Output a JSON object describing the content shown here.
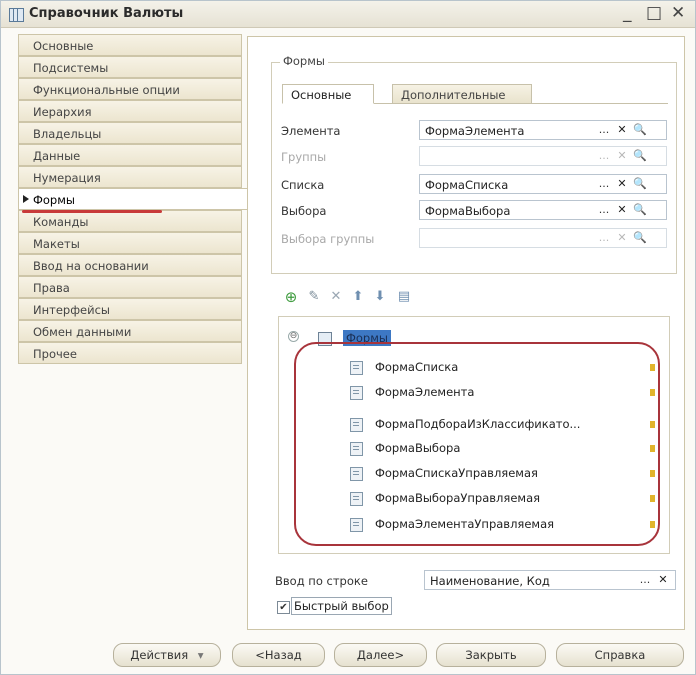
{
  "window": {
    "title": "Справочник Валюты",
    "controls": {
      "minimize": "_",
      "maximize": "□",
      "close": "✕"
    }
  },
  "sidebar": {
    "items": [
      {
        "label": "Основные"
      },
      {
        "label": "Подсистемы"
      },
      {
        "label": "Функциональные опции"
      },
      {
        "label": "Иерархия"
      },
      {
        "label": "Владельцы"
      },
      {
        "label": "Данные"
      },
      {
        "label": "Нумерация"
      },
      {
        "label": "Формы",
        "active": true
      },
      {
        "label": "Команды"
      },
      {
        "label": "Макеты"
      },
      {
        "label": "Ввод на основании"
      },
      {
        "label": "Права"
      },
      {
        "label": "Интерфейсы"
      },
      {
        "label": "Обмен данными"
      },
      {
        "label": "Прочее"
      }
    ]
  },
  "forms_group": {
    "label": "Формы",
    "tabs": [
      {
        "label": "Основные",
        "active": true
      },
      {
        "label": "Дополнительные",
        "active": false
      }
    ],
    "fields": [
      {
        "label": "Элемента",
        "value": "ФормаЭлемента",
        "enabled": true
      },
      {
        "label": "Группы",
        "value": "",
        "enabled": false
      },
      {
        "label": "Списка",
        "value": "ФормаСписка",
        "enabled": true
      },
      {
        "label": "Выбора",
        "value": "ФормаВыбора",
        "enabled": true
      },
      {
        "label": "Выбора группы",
        "value": "",
        "enabled": false
      }
    ],
    "field_buttons": {
      "select": "...",
      "clear": "✕",
      "open": "🔍"
    }
  },
  "toolbar": {
    "icons": [
      "add-icon",
      "edit-icon",
      "delete-icon",
      "move-up-icon",
      "move-down-icon",
      "properties-icon"
    ],
    "glyphs": {
      "add": "⊕",
      "edit": "✎",
      "delete": "✕",
      "up": "⬆",
      "down": "⬇",
      "props": "▤"
    },
    "colors": {
      "add": "#3e9b3e",
      "edit": "#7b8c99",
      "delete": "#9aa7b3",
      "up": "#6f8fb0",
      "down": "#6f8fb0"
    }
  },
  "tree": {
    "root": "Формы",
    "toggle": "⊖",
    "items": [
      "ФормаСписка",
      "ФормаЭлемента",
      "ФормаПодбораИзКлассификато...",
      "ФормаВыбора",
      "ФормаСпискаУправляемая",
      "ФормаВыбораУправляемая",
      "ФормаЭлементаУправляемая"
    ]
  },
  "input_by_string": {
    "label": "Ввод по строке",
    "value": "Наименование, Код",
    "select": "...",
    "clear": "✕"
  },
  "quick_select": {
    "label": "Быстрый выбор",
    "checked": true,
    "check_glyph": "✔"
  },
  "buttons": {
    "actions": "Действия",
    "actions_arrow": "▾",
    "back": "<Назад",
    "next": "Далее>",
    "close": "Закрыть",
    "help": "Справка"
  },
  "colors": {
    "highlight": "#3d78c4",
    "annotation": "#a8343b"
  }
}
